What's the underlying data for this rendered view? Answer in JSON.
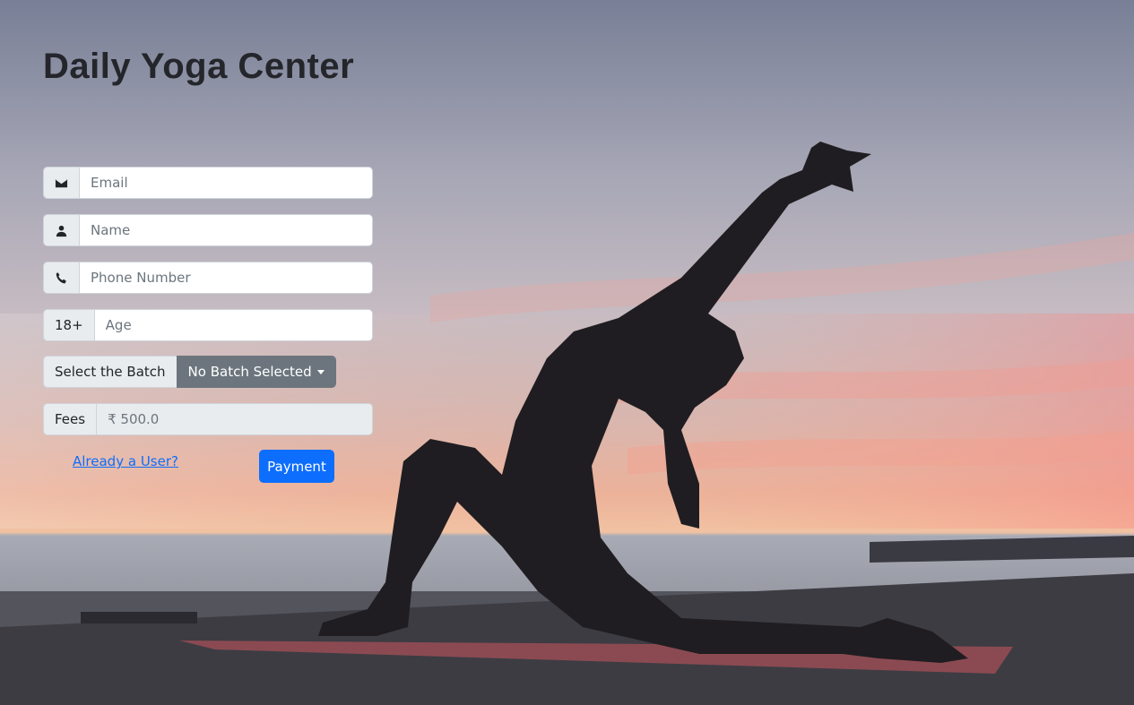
{
  "header": {
    "title": "Daily Yoga Center"
  },
  "form": {
    "email": {
      "icon": "envelope-icon",
      "placeholder": "Email"
    },
    "name": {
      "icon": "user-icon",
      "placeholder": "Name"
    },
    "phone": {
      "icon": "phone-icon",
      "placeholder": "Phone Number"
    },
    "age": {
      "addon": "18+",
      "placeholder": "Age"
    },
    "batch": {
      "label": "Select the Batch",
      "selected": "No Batch Selected"
    },
    "fees": {
      "label": "Fees",
      "value": "₹ 500.0"
    },
    "login_link": "Already a User?",
    "submit_label": "Payment"
  },
  "colors": {
    "primary": "#0d6efd",
    "secondary": "#6c757d",
    "addon_bg": "#e9ecef"
  }
}
